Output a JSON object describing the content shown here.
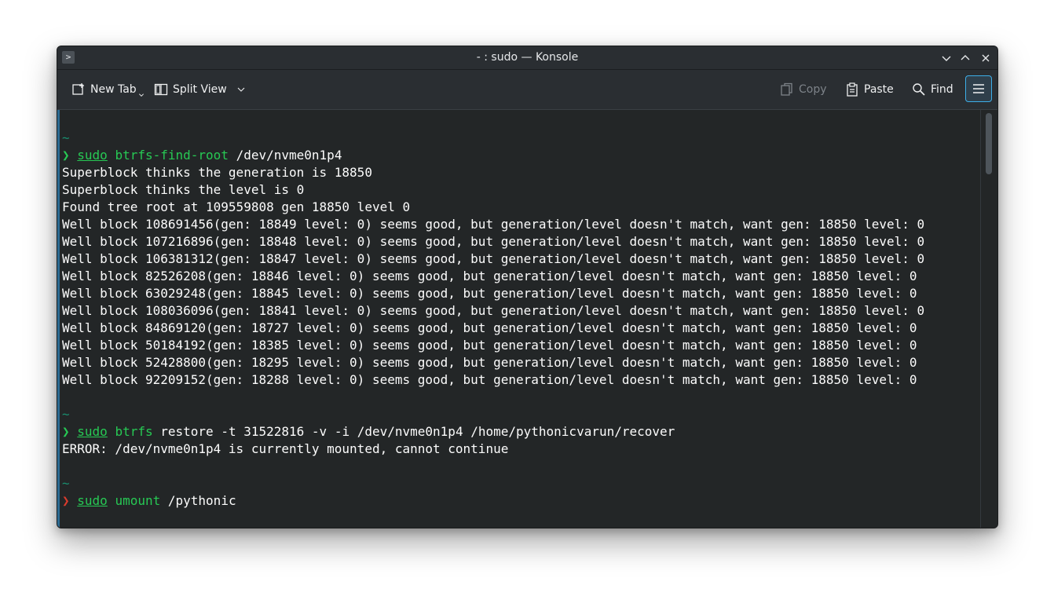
{
  "window": {
    "title": "- : sudo — Konsole",
    "app_icon": ">",
    "controls": [
      "minimize-icon",
      "maximize-icon",
      "close-icon"
    ]
  },
  "toolbar": {
    "new_tab_label": "New Tab",
    "split_view_label": "Split View",
    "copy_label": "Copy",
    "paste_label": "Paste",
    "find_label": "Find"
  },
  "colors": {
    "accent": "#3daee9",
    "prompt_ok": "#27c954",
    "prompt_err": "#da3b2d",
    "tilde": "#1a8f6f",
    "background": "#232627"
  },
  "terminal": {
    "blocks": [
      {
        "tilde": "~",
        "prompt": "❯",
        "prompt_status": "ok",
        "sudo": "sudo",
        "command": "btrfs-find-root",
        "args": " /dev/nvme0n1p4",
        "output": [
          "Superblock thinks the generation is 18850",
          "Superblock thinks the level is 0",
          "Found tree root at 109559808 gen 18850 level 0",
          "Well block 108691456(gen: 18849 level: 0) seems good, but generation/level doesn't match, want gen: 18850 level: 0",
          "Well block 107216896(gen: 18848 level: 0) seems good, but generation/level doesn't match, want gen: 18850 level: 0",
          "Well block 106381312(gen: 18847 level: 0) seems good, but generation/level doesn't match, want gen: 18850 level: 0",
          "Well block 82526208(gen: 18846 level: 0) seems good, but generation/level doesn't match, want gen: 18850 level: 0",
          "Well block 63029248(gen: 18845 level: 0) seems good, but generation/level doesn't match, want gen: 18850 level: 0",
          "Well block 108036096(gen: 18841 level: 0) seems good, but generation/level doesn't match, want gen: 18850 level: 0",
          "Well block 84869120(gen: 18727 level: 0) seems good, but generation/level doesn't match, want gen: 18850 level: 0",
          "Well block 50184192(gen: 18385 level: 0) seems good, but generation/level doesn't match, want gen: 18850 level: 0",
          "Well block 52428800(gen: 18295 level: 0) seems good, but generation/level doesn't match, want gen: 18850 level: 0",
          "Well block 92209152(gen: 18288 level: 0) seems good, but generation/level doesn't match, want gen: 18850 level: 0"
        ]
      },
      {
        "tilde": "~",
        "prompt": "❯",
        "prompt_status": "ok",
        "sudo": "sudo",
        "command": "btrfs",
        "args": " restore -t 31522816 -v -i /dev/nvme0n1p4 /home/pythonicvarun/recover",
        "output": [
          "ERROR: /dev/nvme0n1p4 is currently mounted, cannot continue"
        ]
      },
      {
        "tilde": "~",
        "prompt": "❯",
        "prompt_status": "err",
        "sudo": "sudo",
        "command": "umount",
        "args": " /pythonic",
        "output": []
      }
    ]
  }
}
